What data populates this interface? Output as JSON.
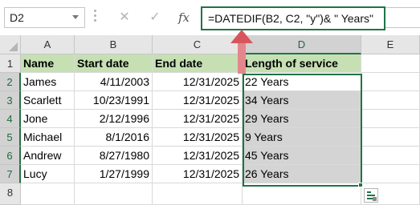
{
  "name_box": {
    "value": "D2"
  },
  "formula_bar": {
    "cancel_icon": "✕",
    "enter_icon": "✓",
    "fx_label": "fx",
    "formula": "=DATEDIF(B2, C2, \"y\")& \" Years\""
  },
  "columns": [
    "A",
    "B",
    "C",
    "D",
    "E"
  ],
  "rows": [
    "1",
    "2",
    "3",
    "4",
    "5",
    "6",
    "7",
    "8"
  ],
  "header_row": {
    "name": "Name",
    "start_date": "Start date",
    "end_date": "End date",
    "length": "Length of service"
  },
  "data_rows": [
    {
      "name": "James",
      "start": "4/11/2003",
      "end": "12/31/2025",
      "length": "22 Years"
    },
    {
      "name": "Scarlett",
      "start": "10/23/1991",
      "end": "12/31/2025",
      "length": "34 Years"
    },
    {
      "name": "Jone",
      "start": "2/12/1996",
      "end": "12/31/2025",
      "length": "29 Years"
    },
    {
      "name": "Michael",
      "start": "8/1/2016",
      "end": "12/31/2025",
      "length": "9 Years"
    },
    {
      "name": "Andrew",
      "start": "8/27/1980",
      "end": "12/31/2025",
      "length": "45 Years"
    },
    {
      "name": "Lucy",
      "start": "1/27/1999",
      "end": "12/31/2025",
      "length": "26 Years"
    }
  ],
  "colors": {
    "accent": "#217346",
    "header_fill": "#c6e0b4",
    "arrow": "#e3878c"
  }
}
